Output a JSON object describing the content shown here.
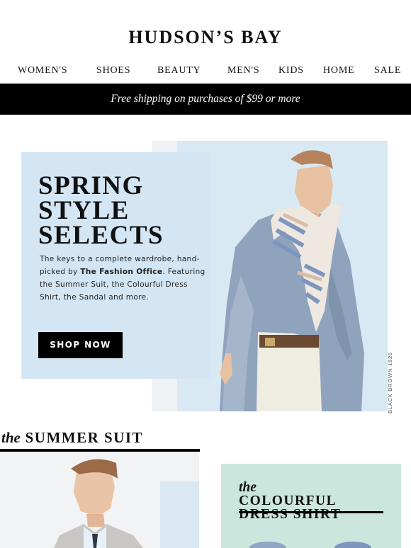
{
  "header": {
    "logo_text": "HUDSON’S BAY"
  },
  "nav": {
    "items": [
      {
        "label": "WOMEN'S"
      },
      {
        "label": "SHOES"
      },
      {
        "label": "BEAUTY"
      },
      {
        "label": "MEN'S"
      },
      {
        "label": "KIDS"
      },
      {
        "label": "HOME"
      },
      {
        "label": "SALE"
      }
    ]
  },
  "promo": {
    "text": "Free shipping on purchases of $99 or more"
  },
  "hero": {
    "title_lines": [
      "SPRING",
      "STYLE",
      "SELECTS"
    ],
    "body_lead": "The keys to a complete wardrobe, hand-picked by ",
    "body_emphasis": "The Fashion Office",
    "body_tail": ". Featuring the Summer Suit, the Colourful Dress Shirt, the Sandal and more.",
    "cta_label": "SHOP NOW",
    "photo_credit": "BLACK BROWN 1826"
  },
  "summer_suit": {
    "the": "the",
    "title": "SUMMER SUIT"
  },
  "dress_shirt": {
    "the": "the",
    "line1": "COLOURFUL",
    "line2": "DRESS SHIRT"
  },
  "colors": {
    "promo_bg": "#000000",
    "hero_card_bg": "#d4e6f4",
    "hero_photo_bg": "#d8e9f3",
    "dress_card_bg": "#cbe6dc",
    "cta_bg": "#000000"
  }
}
